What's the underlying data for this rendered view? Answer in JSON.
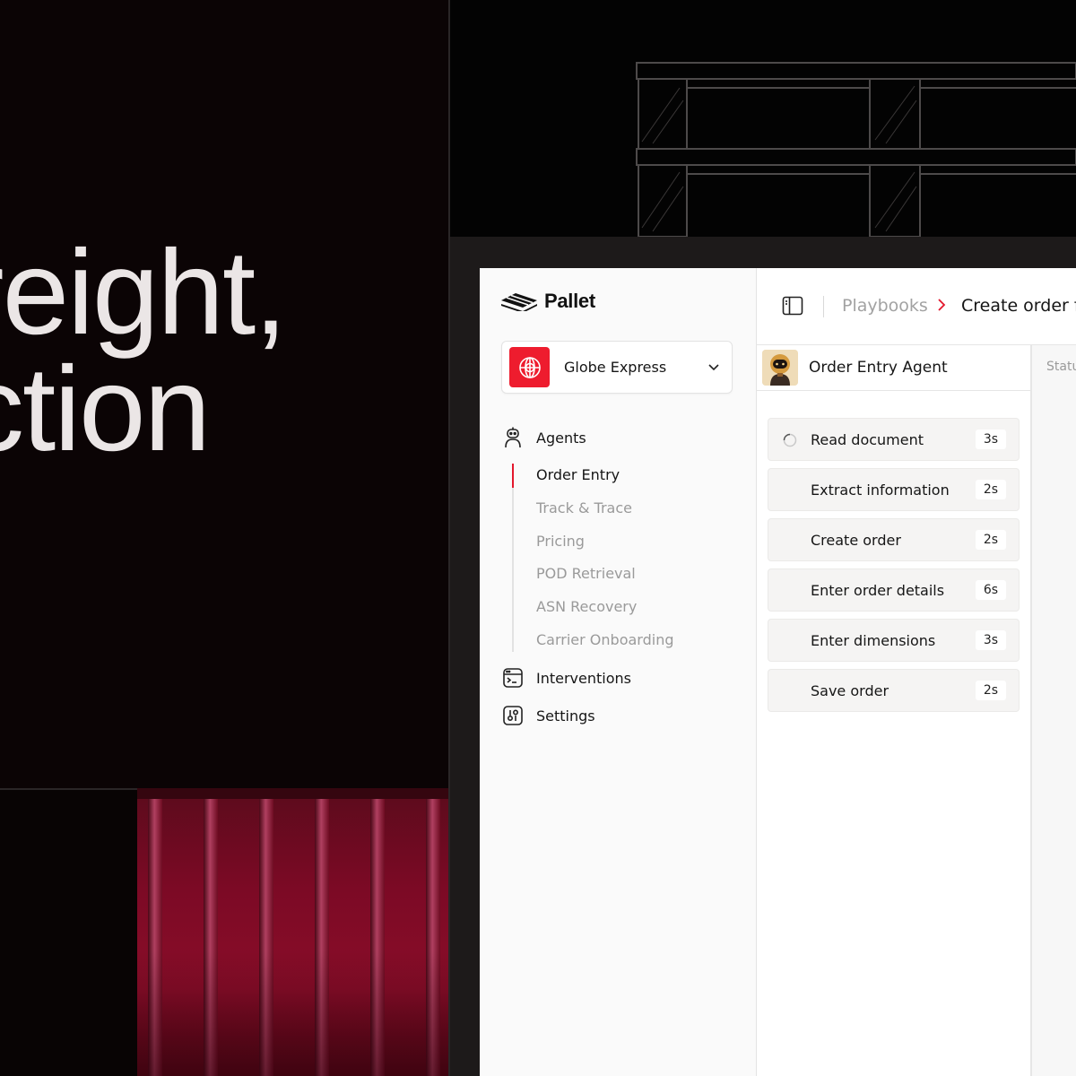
{
  "hero": {
    "headline": "reight,\nction"
  },
  "app": {
    "brand": "Pallet",
    "org": {
      "name": "Globe Express"
    },
    "nav": {
      "agents": "Agents",
      "sub_items": [
        "Order Entry",
        "Track & Trace",
        "Pricing",
        "POD Retrieval",
        "ASN Recovery",
        "Carrier Onboarding"
      ],
      "active_sub_item": "Order Entry",
      "interventions": "Interventions",
      "settings": "Settings"
    },
    "breadcrumb": {
      "root": "Playbooks",
      "current": "Create order fr"
    },
    "agent": {
      "name": "Order Entry Agent",
      "status_header": "Statu",
      "steps": [
        {
          "name": "Read document",
          "duration": "3s",
          "running": true
        },
        {
          "name": "Extract information",
          "duration": "2s",
          "running": false
        },
        {
          "name": "Create order",
          "duration": "2s",
          "running": false
        },
        {
          "name": "Enter order details",
          "duration": "6s",
          "running": false
        },
        {
          "name": "Enter dimensions",
          "duration": "3s",
          "running": false
        },
        {
          "name": "Save order",
          "duration": "2s",
          "running": false
        }
      ]
    }
  },
  "colors": {
    "accent": "#e3172c",
    "org_logo": "#ee1c2e",
    "background_dark": "#0b0405",
    "container_red": "#7c0a25"
  }
}
